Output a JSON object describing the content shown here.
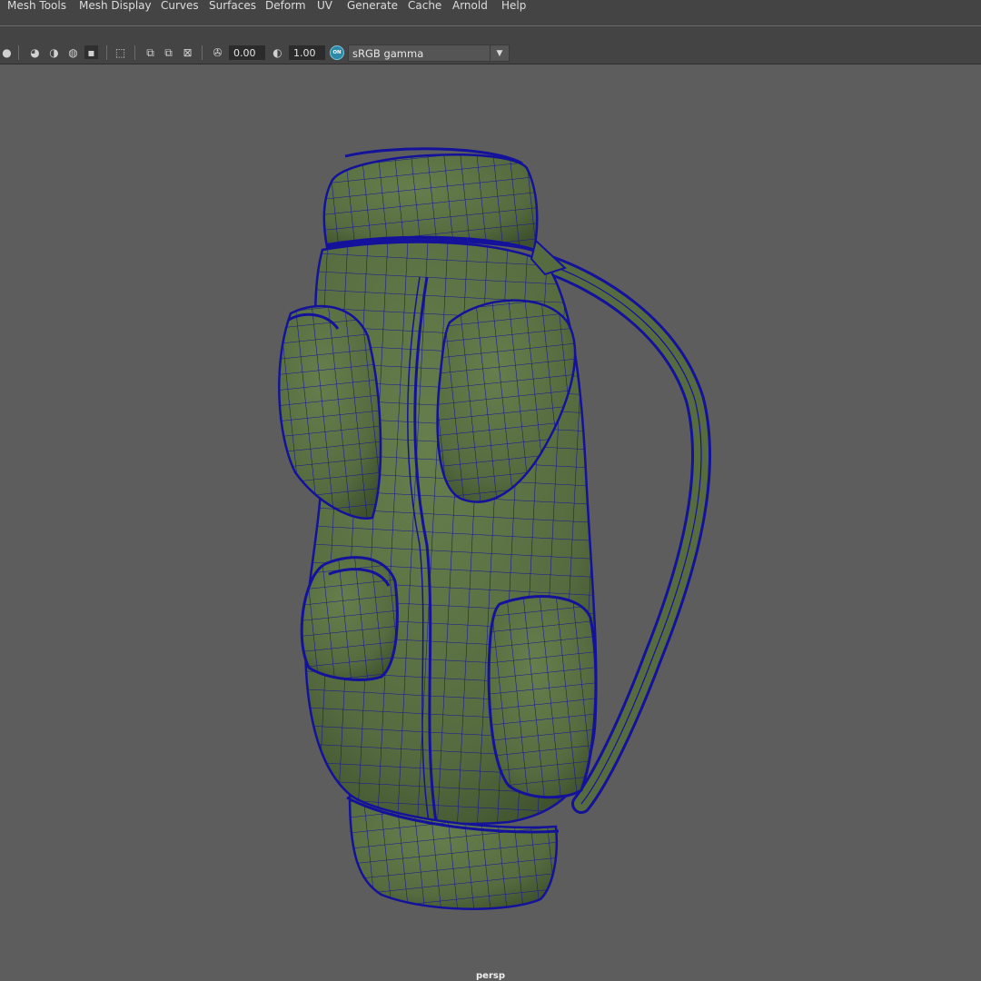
{
  "menubar": {
    "items": [
      "Mesh Tools",
      "Mesh Display",
      "Curves",
      "Surfaces",
      "Deform",
      "UV",
      "Generate",
      "Cache",
      "Arnold",
      "Help"
    ]
  },
  "status_toolbar": {
    "exposure_value": "0.00",
    "gamma_value": "1.00",
    "color_management_badge": "ON",
    "view_transform": "sRGB gamma",
    "icons": [
      "shading-ball-icon",
      "lighting-icon",
      "shadow-icon",
      "ambient-occlusion-icon",
      "isolate-select-icon",
      "selection-mask-icon",
      "xray-icon",
      "xray-joints-icon",
      "backface-culling-icon",
      "wireframe-on-shaded-icon",
      "exposure-icon",
      "gamma-icon"
    ]
  },
  "viewport": {
    "camera": "persp",
    "background_color": "#5d5d5d",
    "mesh_fill_color": "#5a7142",
    "wireframe_color": "#14129a"
  }
}
